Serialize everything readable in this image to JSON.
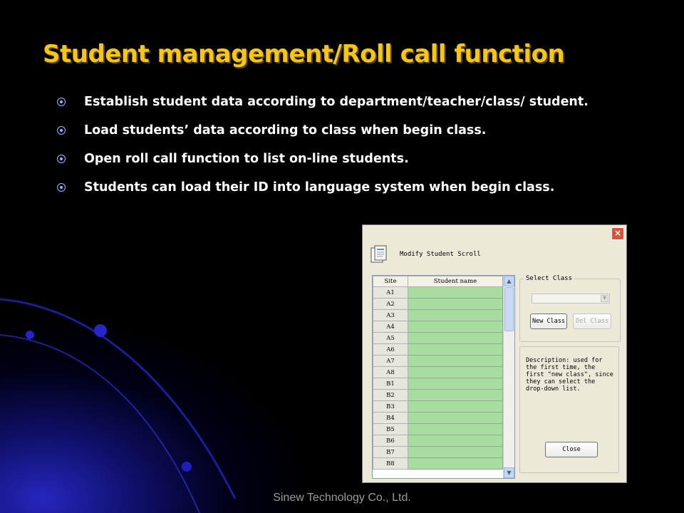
{
  "slide": {
    "title": "Student management/Roll call function",
    "bullets": [
      "Establish student data  according to department/teacher/class/ student.",
      "Load students’ data according to class when begin class.",
      "Open roll call function to list on-line students.",
      "Students can load their ID into language system when begin class."
    ],
    "footer": "Sinew Technology Co., Ltd."
  },
  "dialog": {
    "title": "Modify Student Scroll",
    "close_label": "×",
    "grid": {
      "columns": [
        "Site",
        "Student name"
      ],
      "rows": [
        "A1",
        "A2",
        "A3",
        "A4",
        "A5",
        "A6",
        "A7",
        "A8",
        "B1",
        "B2",
        "B3",
        "B4",
        "B5",
        "B6",
        "B7",
        "B8"
      ]
    },
    "select_class": {
      "legend": "Select Class",
      "selected_value": "",
      "new_class_label": "New Class",
      "del_class_label": "Del Class"
    },
    "description": "Description: used for the first time, the first \"new class\", since they can select the drop-down list.",
    "close_button_label": "Close"
  },
  "colors": {
    "title": "#f5c518",
    "grid_name_cell": "#a9dca0",
    "dialog_bg": "#ece9d8"
  }
}
